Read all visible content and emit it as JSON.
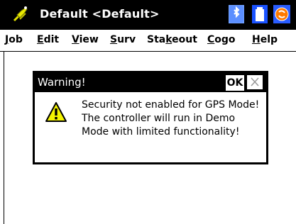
{
  "titlebar": {
    "title": "Default <Default>",
    "app_icon": "satellite-icon",
    "status_icons": [
      "bluetooth-icon",
      "battery-icon",
      "sync-icon"
    ]
  },
  "menubar": {
    "items": [
      {
        "pre": "",
        "u": "J",
        "post": "ob"
      },
      {
        "pre": "",
        "u": "E",
        "post": "dit"
      },
      {
        "pre": "",
        "u": "V",
        "post": "iew"
      },
      {
        "pre": "",
        "u": "S",
        "post": "urv"
      },
      {
        "pre": "Sta",
        "u": "k",
        "post": "eout"
      },
      {
        "pre": "",
        "u": "C",
        "post": "ogo"
      },
      {
        "pre": "",
        "u": "H",
        "post": "elp"
      }
    ]
  },
  "dialog": {
    "title": "Warning!",
    "ok_label": "OK",
    "icon": "warning-icon",
    "message_lines": [
      "Security not enabled for GPS Mode!",
      "The controller will run in Demo",
      "Mode with limited functionality!"
    ]
  },
  "colors": {
    "titlebar_bg": "#000000",
    "accent_blue": "#1a52ff",
    "warning_yellow": "#f4f400"
  }
}
